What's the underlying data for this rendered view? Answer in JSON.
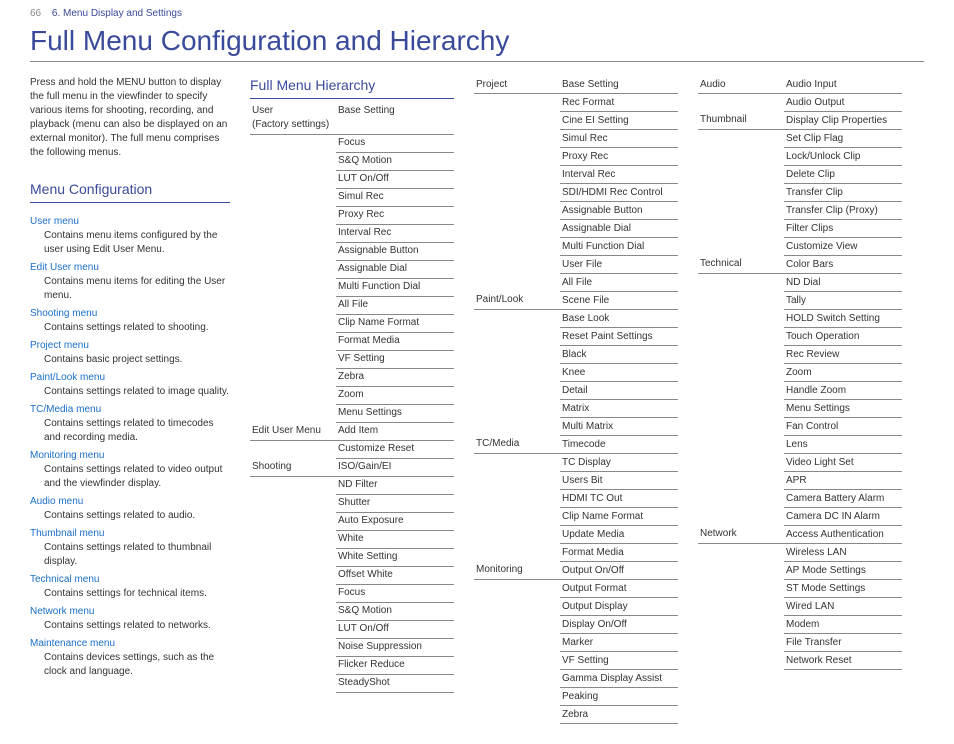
{
  "header": {
    "page_number": "66",
    "chapter": "6. Menu Display and Settings"
  },
  "title": "Full Menu Configuration and Hierarchy",
  "intro": "Press and hold the MENU button to display the full menu in the viewfinder to specify various items for shooting, recording, and playback (menu can also be displayed on an external monitor). The full menu comprises the following menus.",
  "section_config": "Menu Configuration",
  "menus": [
    {
      "name": "User menu",
      "desc": "Contains menu items configured by the user using Edit User Menu."
    },
    {
      "name": "Edit User menu",
      "desc": "Contains menu items for editing the User menu."
    },
    {
      "name": "Shooting menu",
      "desc": "Contains settings related to shooting."
    },
    {
      "name": "Project menu",
      "desc": "Contains basic project settings."
    },
    {
      "name": "Paint/Look menu",
      "desc": "Contains settings related to image quality."
    },
    {
      "name": "TC/Media menu",
      "desc": "Contains settings related to timecodes and recording media."
    },
    {
      "name": "Monitoring menu",
      "desc": "Contains settings related to video output and the viewfinder display."
    },
    {
      "name": "Audio menu",
      "desc": "Contains settings related to audio."
    },
    {
      "name": "Thumbnail menu",
      "desc": "Contains settings related to thumbnail display."
    },
    {
      "name": "Technical menu",
      "desc": "Contains settings for technical items."
    },
    {
      "name": "Network menu",
      "desc": "Contains settings related to networks."
    },
    {
      "name": "Maintenance menu",
      "desc": "Contains devices settings, such as the clock and language."
    }
  ],
  "section_hier": "Full Menu Hierarchy",
  "col2_rows": [
    {
      "cat": "User",
      "catsub": "(Factory settings)",
      "item": "Base Setting",
      "catline": true
    },
    {
      "cat": "",
      "item": "Focus"
    },
    {
      "cat": "",
      "item": "S&Q Motion"
    },
    {
      "cat": "",
      "item": "LUT On/Off"
    },
    {
      "cat": "",
      "item": "Simul Rec"
    },
    {
      "cat": "",
      "item": "Proxy Rec"
    },
    {
      "cat": "",
      "item": "Interval Rec"
    },
    {
      "cat": "",
      "item": "Assignable Button"
    },
    {
      "cat": "",
      "item": "Assignable Dial"
    },
    {
      "cat": "",
      "item": "Multi Function Dial"
    },
    {
      "cat": "",
      "item": "All File"
    },
    {
      "cat": "",
      "item": "Clip Name Format"
    },
    {
      "cat": "",
      "item": "Format Media"
    },
    {
      "cat": "",
      "item": "VF Setting"
    },
    {
      "cat": "",
      "item": "Zebra"
    },
    {
      "cat": "",
      "item": "Zoom"
    },
    {
      "cat": "",
      "item": "Menu Settings"
    },
    {
      "cat": "Edit User Menu",
      "item": "Add Item",
      "catline": true
    },
    {
      "cat": "",
      "item": "Customize Reset"
    },
    {
      "cat": "Shooting",
      "item": "ISO/Gain/EI",
      "catline": true
    },
    {
      "cat": "",
      "item": "ND Filter"
    },
    {
      "cat": "",
      "item": "Shutter"
    },
    {
      "cat": "",
      "item": "Auto Exposure"
    },
    {
      "cat": "",
      "item": "White"
    },
    {
      "cat": "",
      "item": "White Setting"
    },
    {
      "cat": "",
      "item": "Offset White"
    },
    {
      "cat": "",
      "item": "Focus"
    },
    {
      "cat": "",
      "item": "S&Q Motion"
    },
    {
      "cat": "",
      "item": "LUT On/Off"
    },
    {
      "cat": "",
      "item": "Noise Suppression"
    },
    {
      "cat": "",
      "item": "Flicker Reduce"
    },
    {
      "cat": "",
      "item": "SteadyShot"
    }
  ],
  "col3_rows": [
    {
      "cat": "Project",
      "item": "Base Setting",
      "catline": true
    },
    {
      "cat": "",
      "item": "Rec Format"
    },
    {
      "cat": "",
      "item": "Cine EI Setting"
    },
    {
      "cat": "",
      "item": "Simul Rec"
    },
    {
      "cat": "",
      "item": "Proxy Rec"
    },
    {
      "cat": "",
      "item": "Interval Rec"
    },
    {
      "cat": "",
      "item": "SDI/HDMI Rec Control"
    },
    {
      "cat": "",
      "item": "Assignable Button"
    },
    {
      "cat": "",
      "item": "Assignable Dial"
    },
    {
      "cat": "",
      "item": "Multi Function Dial"
    },
    {
      "cat": "",
      "item": "User File"
    },
    {
      "cat": "",
      "item": "All File"
    },
    {
      "cat": "Paint/Look",
      "item": "Scene File",
      "catline": true
    },
    {
      "cat": "",
      "item": "Base Look"
    },
    {
      "cat": "",
      "item": "Reset Paint Settings"
    },
    {
      "cat": "",
      "item": "Black"
    },
    {
      "cat": "",
      "item": "Knee"
    },
    {
      "cat": "",
      "item": "Detail"
    },
    {
      "cat": "",
      "item": "Matrix"
    },
    {
      "cat": "",
      "item": "Multi Matrix"
    },
    {
      "cat": "TC/Media",
      "item": "Timecode",
      "catline": true
    },
    {
      "cat": "",
      "item": "TC Display"
    },
    {
      "cat": "",
      "item": "Users Bit"
    },
    {
      "cat": "",
      "item": "HDMI TC Out"
    },
    {
      "cat": "",
      "item": "Clip Name Format"
    },
    {
      "cat": "",
      "item": "Update Media"
    },
    {
      "cat": "",
      "item": "Format Media"
    },
    {
      "cat": "Monitoring",
      "item": "Output On/Off",
      "catline": true
    },
    {
      "cat": "",
      "item": "Output Format"
    },
    {
      "cat": "",
      "item": "Output Display"
    },
    {
      "cat": "",
      "item": "Display On/Off"
    },
    {
      "cat": "",
      "item": "Marker"
    },
    {
      "cat": "",
      "item": "VF Setting"
    },
    {
      "cat": "",
      "item": "Gamma Display Assist"
    },
    {
      "cat": "",
      "item": "Peaking"
    },
    {
      "cat": "",
      "item": "Zebra"
    }
  ],
  "col4_rows": [
    {
      "cat": "Audio",
      "item": "Audio Input",
      "catline": true
    },
    {
      "cat": "",
      "item": "Audio Output"
    },
    {
      "cat": "Thumbnail",
      "item": "Display Clip Properties",
      "catline": true
    },
    {
      "cat": "",
      "item": "Set Clip Flag"
    },
    {
      "cat": "",
      "item": "Lock/Unlock Clip"
    },
    {
      "cat": "",
      "item": "Delete Clip"
    },
    {
      "cat": "",
      "item": "Transfer Clip"
    },
    {
      "cat": "",
      "item": "Transfer Clip (Proxy)"
    },
    {
      "cat": "",
      "item": "Filter Clips"
    },
    {
      "cat": "",
      "item": "Customize View"
    },
    {
      "cat": "Technical",
      "item": "Color Bars",
      "catline": true
    },
    {
      "cat": "",
      "item": "ND Dial"
    },
    {
      "cat": "",
      "item": "Tally"
    },
    {
      "cat": "",
      "item": "HOLD Switch Setting"
    },
    {
      "cat": "",
      "item": "Touch Operation"
    },
    {
      "cat": "",
      "item": "Rec Review"
    },
    {
      "cat": "",
      "item": "Zoom"
    },
    {
      "cat": "",
      "item": "Handle Zoom"
    },
    {
      "cat": "",
      "item": "Menu Settings"
    },
    {
      "cat": "",
      "item": "Fan Control"
    },
    {
      "cat": "",
      "item": "Lens"
    },
    {
      "cat": "",
      "item": "Video Light Set"
    },
    {
      "cat": "",
      "item": "APR"
    },
    {
      "cat": "",
      "item": "Camera Battery Alarm"
    },
    {
      "cat": "",
      "item": "Camera DC IN Alarm"
    },
    {
      "cat": "Network",
      "item": "Access Authentication",
      "catline": true
    },
    {
      "cat": "",
      "item": "Wireless LAN"
    },
    {
      "cat": "",
      "item": "AP Mode Settings"
    },
    {
      "cat": "",
      "item": "ST Mode Settings"
    },
    {
      "cat": "",
      "item": "Wired LAN"
    },
    {
      "cat": "",
      "item": "Modem"
    },
    {
      "cat": "",
      "item": "File Transfer"
    },
    {
      "cat": "",
      "item": "Network Reset"
    }
  ]
}
